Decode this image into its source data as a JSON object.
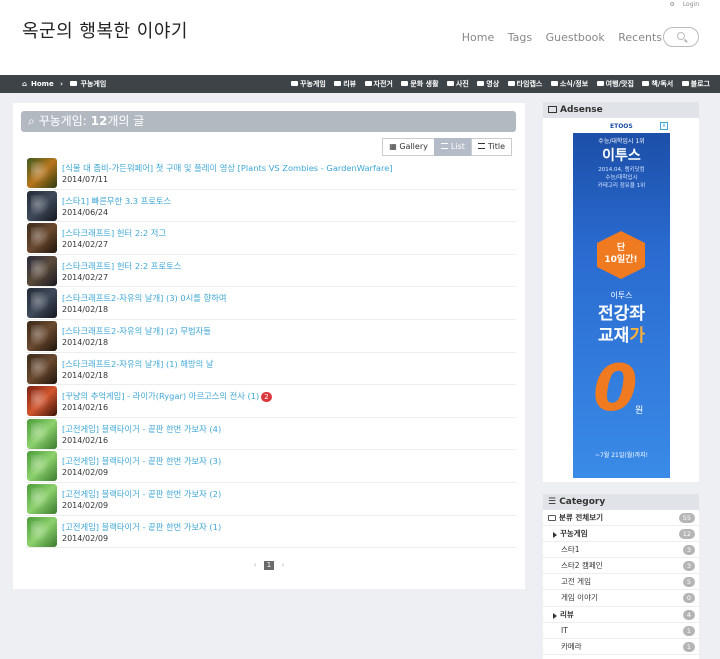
{
  "site": {
    "title": "옥군의 행복한 이야기",
    "top_links": {
      "settings": "⚙",
      "login": "Login"
    },
    "nav": [
      "Home",
      "Tags",
      "Guestbook",
      "Recents"
    ]
  },
  "breadcrumb": {
    "home": "Home",
    "sep": "›",
    "current": "꾸농게임"
  },
  "categories_bar": [
    "꾸농게임",
    "리뷰",
    "자전거",
    "문화 생활",
    "사진",
    "영상",
    "타임캡스",
    "소식/정보",
    "여행/맛집",
    "책/독서",
    "블로그"
  ],
  "main": {
    "heading_prefix": "꾸농게임:",
    "heading_count": "12",
    "heading_suffix": "개의 글",
    "views": {
      "gallery": "Gallery",
      "list": "List",
      "title": "Title"
    },
    "posts": [
      {
        "title": "[식물 대 좀비-가든워페어] 첫 구매 및 플레이 영상 [Plants VS Zombies - GardenWarfare]",
        "date": "2014/07/11",
        "badge": ""
      },
      {
        "title": "[스타1] 빠른무한 3.3 프로토스",
        "date": "2014/06/24",
        "badge": ""
      },
      {
        "title": "[스타크래프트] 헌터 2:2 저그",
        "date": "2014/02/27",
        "badge": ""
      },
      {
        "title": "[스타크래프트] 헌터 2:2 프로토스",
        "date": "2014/02/27",
        "badge": ""
      },
      {
        "title": "[스타크래프트2-자유의 날개] (3) 0시를 향하여",
        "date": "2014/02/18",
        "badge": ""
      },
      {
        "title": "[스타크래프트2-자유의 날개] (2) 무법자들",
        "date": "2014/02/18",
        "badge": ""
      },
      {
        "title": "[스타크래프트2-자유의 날개] (1) 해방의 날",
        "date": "2014/02/18",
        "badge": ""
      },
      {
        "title": "[꾸냥의 추억게임] - 라이가(Rygar) 아르고스의 전사 (1)",
        "date": "2014/02/16",
        "badge": "2"
      },
      {
        "title": "[고전게임] 블랙타이거 - 끝판 한번 가보자 (4)",
        "date": "2014/02/16",
        "badge": ""
      },
      {
        "title": "[고전게임] 블랙타이거 - 끝판 한번 가보자 (3)",
        "date": "2014/02/09",
        "badge": ""
      },
      {
        "title": "[고전게임] 블랙타이거 - 끝판 한번 가보자 (2)",
        "date": "2014/02/09",
        "badge": ""
      },
      {
        "title": "[고전게임] 블랙타이거 - 끝판 한번 가보자 (1)",
        "date": "2014/02/09",
        "badge": ""
      }
    ],
    "pager": {
      "prev": "‹",
      "current": "1",
      "next": "›"
    }
  },
  "sidebar": {
    "adsense_title": "Adsense",
    "ad": {
      "logo": "ETOOS",
      "tagline": "수능/대학입시 1위",
      "brand": "이투스",
      "sub1": "2014.04, 랭키닷컴",
      "sub2": "수능/대학입시",
      "sub3": "카테고리 점유율 1위",
      "hex1": "단",
      "hex2": "10일간!",
      "line3": "이투스",
      "big1": "전강좌",
      "big2a": "교재",
      "big2b": "가",
      "zero": "0",
      "won": "원",
      "foot": "~7월 21일(월)까지!",
      "close": "x"
    },
    "category_title": "Category",
    "category_items": [
      {
        "label": "분류 전체보기",
        "count": "55",
        "kind": "root"
      },
      {
        "label": "꾸농게임",
        "count": "12",
        "kind": "parent"
      },
      {
        "label": "스타1",
        "count": "3",
        "kind": "child"
      },
      {
        "label": "스타2 캠페인",
        "count": "3",
        "kind": "child"
      },
      {
        "label": "고전 게임",
        "count": "5",
        "kind": "child"
      },
      {
        "label": "게임 이야기",
        "count": "0",
        "kind": "child"
      },
      {
        "label": "리뷰",
        "count": "4",
        "kind": "parent"
      },
      {
        "label": "IT",
        "count": "1",
        "kind": "child"
      },
      {
        "label": "카메라",
        "count": "1",
        "kind": "child"
      }
    ]
  }
}
